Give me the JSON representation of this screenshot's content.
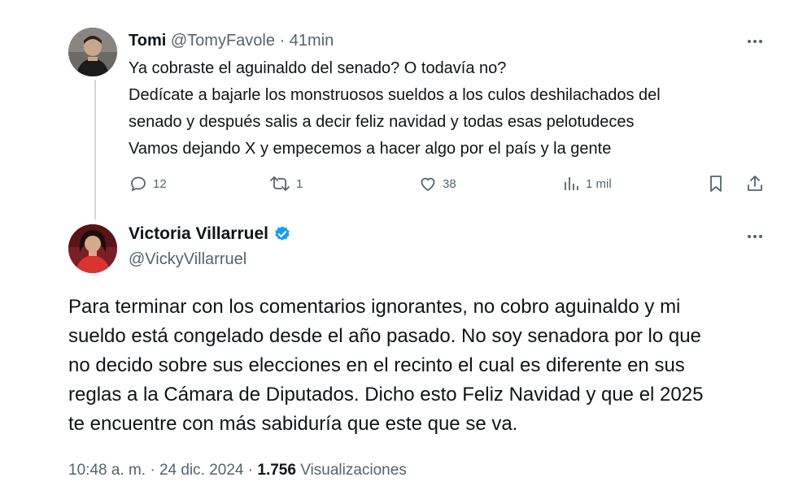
{
  "reply": {
    "author_name": "Tomi",
    "author_handle": "@TomyFavole",
    "separator": "·",
    "time_ago": "41min",
    "lines": [
      "Ya cobraste el aguinaldo del senado? O todavía no?",
      "Dedícate a bajarle los monstruosos sueldos a los culos deshilachados del",
      "senado y después salis a decir feliz navidad y todas esas pelotudeces",
      "Vamos dejando X y empecemos a hacer algo por el país y la gente"
    ],
    "actions": {
      "reply_count": "12",
      "repost_count": "1",
      "like_count": "38",
      "views_count": "1 mil"
    }
  },
  "main_post": {
    "author_name": "Victoria Villarruel",
    "author_handle": "@VickyVillarruel",
    "verified": true,
    "lines": [
      "Para terminar con los comentarios ignorantes, no cobro aguinaldo y mi",
      "sueldo está congelado desde el año pasado. No soy senadora por lo que",
      "no decido sobre sus elecciones en el recinto el cual es diferente en sus",
      "reglas a la Cámara de Diputados. Dicho esto Feliz Navidad y que el 2025",
      "te encuentre con más sabiduría que este que se va."
    ],
    "timestamp": "10:48 a. m.",
    "separator": "·",
    "date": "24 dic. 2024",
    "views_count": "1.756",
    "views_label": "Visualizaciones"
  },
  "icons": {
    "reply": "reply-icon",
    "repost": "repost-icon",
    "like": "heart-icon",
    "views": "views-icon",
    "bookmark": "bookmark-icon",
    "share": "share-icon",
    "more": "more-icon",
    "verified": "verified-badge-icon"
  },
  "colors": {
    "text": "#0f1419",
    "muted": "#536471",
    "verified": "#1d9bf0",
    "thread_line": "#cfd9de"
  }
}
